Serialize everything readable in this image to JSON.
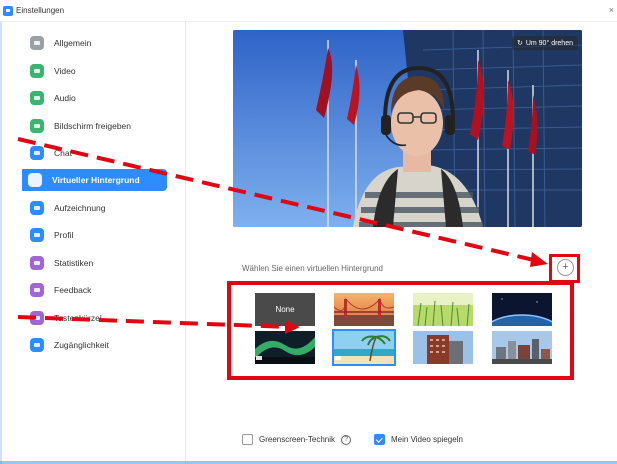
{
  "window": {
    "title": "Einstellungen"
  },
  "sidebar": {
    "items": [
      {
        "label": "Allgemein",
        "icon": "gear-icon",
        "color": "#9aa0a6"
      },
      {
        "label": "Video",
        "icon": "video-camera-icon",
        "color": "#3cb371"
      },
      {
        "label": "Audio",
        "icon": "headphones-icon",
        "color": "#3cb371"
      },
      {
        "label": "Bildschirm freigeben",
        "icon": "screen-share-icon",
        "color": "#3cb371"
      },
      {
        "label": "Chat",
        "icon": "chat-bubble-icon",
        "color": "#2d8cff"
      },
      {
        "label": "Virtueller Hintergrund",
        "icon": "virtual-background-icon",
        "color": "#2d8cff",
        "active": true
      },
      {
        "label": "Aufzeichnung",
        "icon": "record-icon",
        "color": "#2d8cff"
      },
      {
        "label": "Profil",
        "icon": "profile-icon",
        "color": "#2d8cff"
      },
      {
        "label": "Statistiken",
        "icon": "statistics-icon",
        "color": "#a066d3"
      },
      {
        "label": "Feedback",
        "icon": "feedback-icon",
        "color": "#a066d3"
      },
      {
        "label": "Tastenkürzel",
        "icon": "keyboard-icon",
        "color": "#a066d3"
      },
      {
        "label": "Zugänglichkeit",
        "icon": "accessibility-icon",
        "color": "#2d8cff"
      }
    ]
  },
  "preview": {
    "rotate_label": "Um 90° drehen"
  },
  "backgrounds": {
    "label": "Wählen Sie einen virtuellen Hintergrund",
    "none_label": "None",
    "items": [
      {
        "name": "None"
      },
      {
        "name": "golden-gate-bridge"
      },
      {
        "name": "grass"
      },
      {
        "name": "earth-from-space"
      },
      {
        "name": "aurora"
      },
      {
        "name": "beach"
      },
      {
        "name": "building-red"
      },
      {
        "name": "city-skyline"
      }
    ]
  },
  "options": {
    "greenscreen_label": "Greenscreen-Technik",
    "greenscreen_checked": false,
    "mirror_label": "Mein Video spiegeln",
    "mirror_checked": true
  },
  "colors": {
    "accent": "#2d8cff",
    "annotation": "#e20613"
  }
}
